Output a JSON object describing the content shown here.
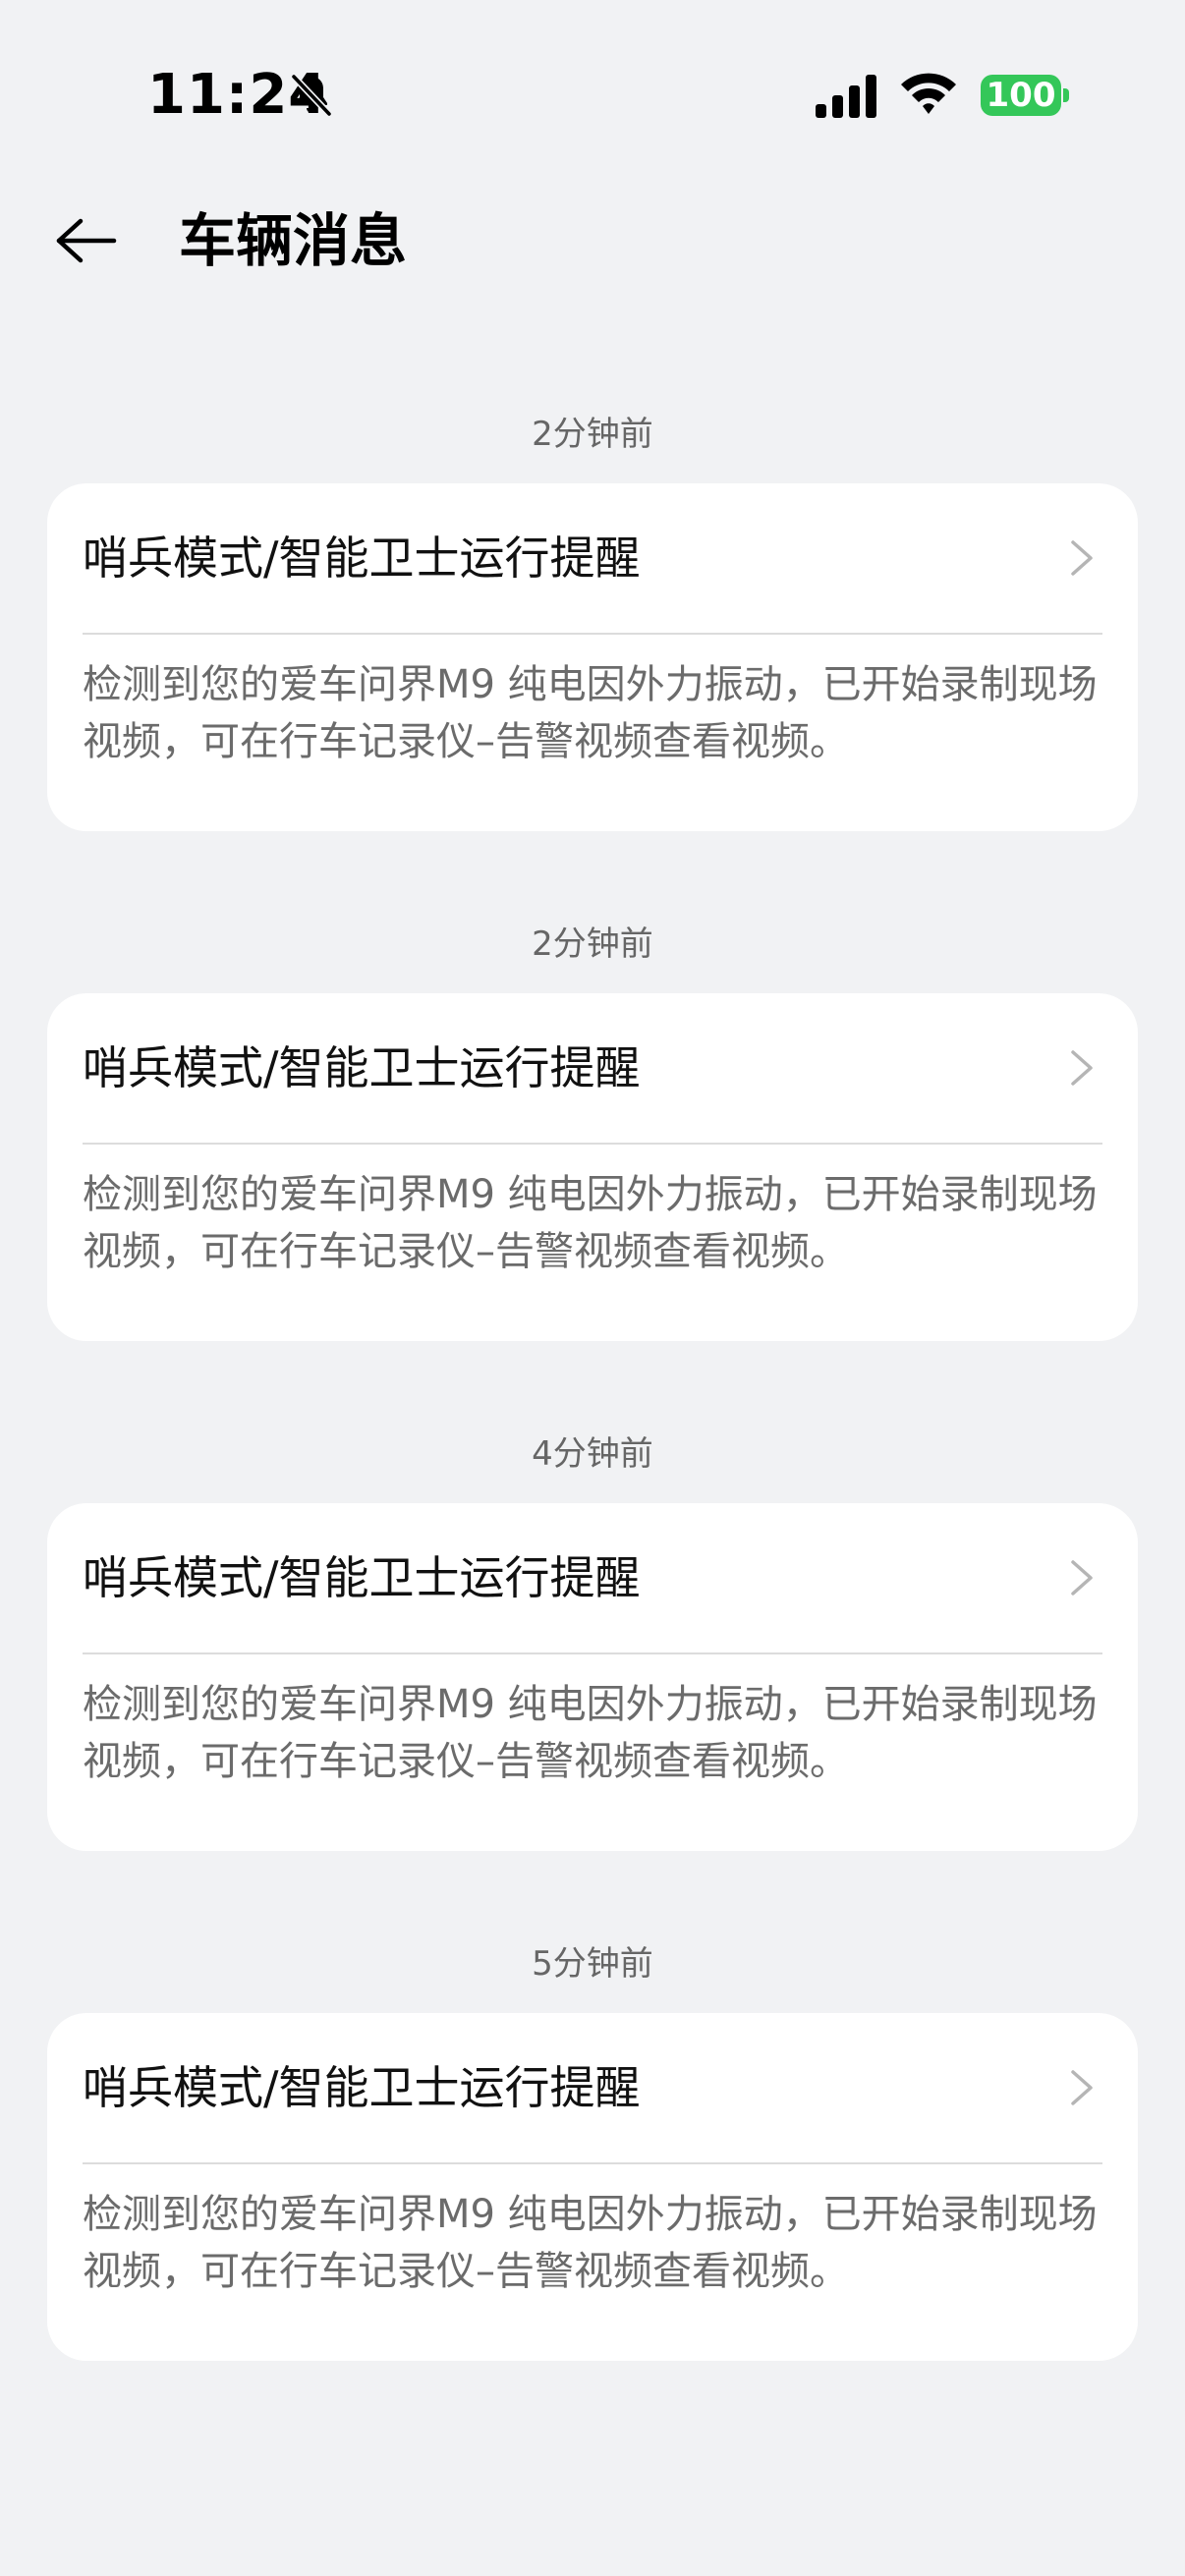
{
  "status_bar": {
    "time": "11:24",
    "icons": [
      "bell-off-icon",
      "signal-icon",
      "wifi-icon"
    ],
    "battery_level": "100",
    "battery_color": "#34c759"
  },
  "header": {
    "back_icon": "arrow-left-icon",
    "title": "车辆消息"
  },
  "colors": {
    "background": "#f1f2f4",
    "card": "#ffffff",
    "secondary_text": "#6b6b6b"
  },
  "messages": [
    {
      "timestamp": "2分钟前",
      "title": "哨兵模式/智能卫士运行提醒",
      "body": "检测到您的爱车问界M9 纯电因外力振动，已开始录制现场视频，可在行车记录仪–告警视频查看视频。"
    },
    {
      "timestamp": "2分钟前",
      "title": "哨兵模式/智能卫士运行提醒",
      "body": "检测到您的爱车问界M9 纯电因外力振动，已开始录制现场视频，可在行车记录仪–告警视频查看视频。"
    },
    {
      "timestamp": "4分钟前",
      "title": "哨兵模式/智能卫士运行提醒",
      "body": "检测到您的爱车问界M9 纯电因外力振动，已开始录制现场视频，可在行车记录仪–告警视频查看视频。"
    },
    {
      "timestamp": "5分钟前",
      "title": "哨兵模式/智能卫士运行提醒",
      "body": "检测到您的爱车问界M9 纯电因外力振动，已开始录制现场视频，可在行车记录仪–告警视频查看视频。"
    }
  ]
}
